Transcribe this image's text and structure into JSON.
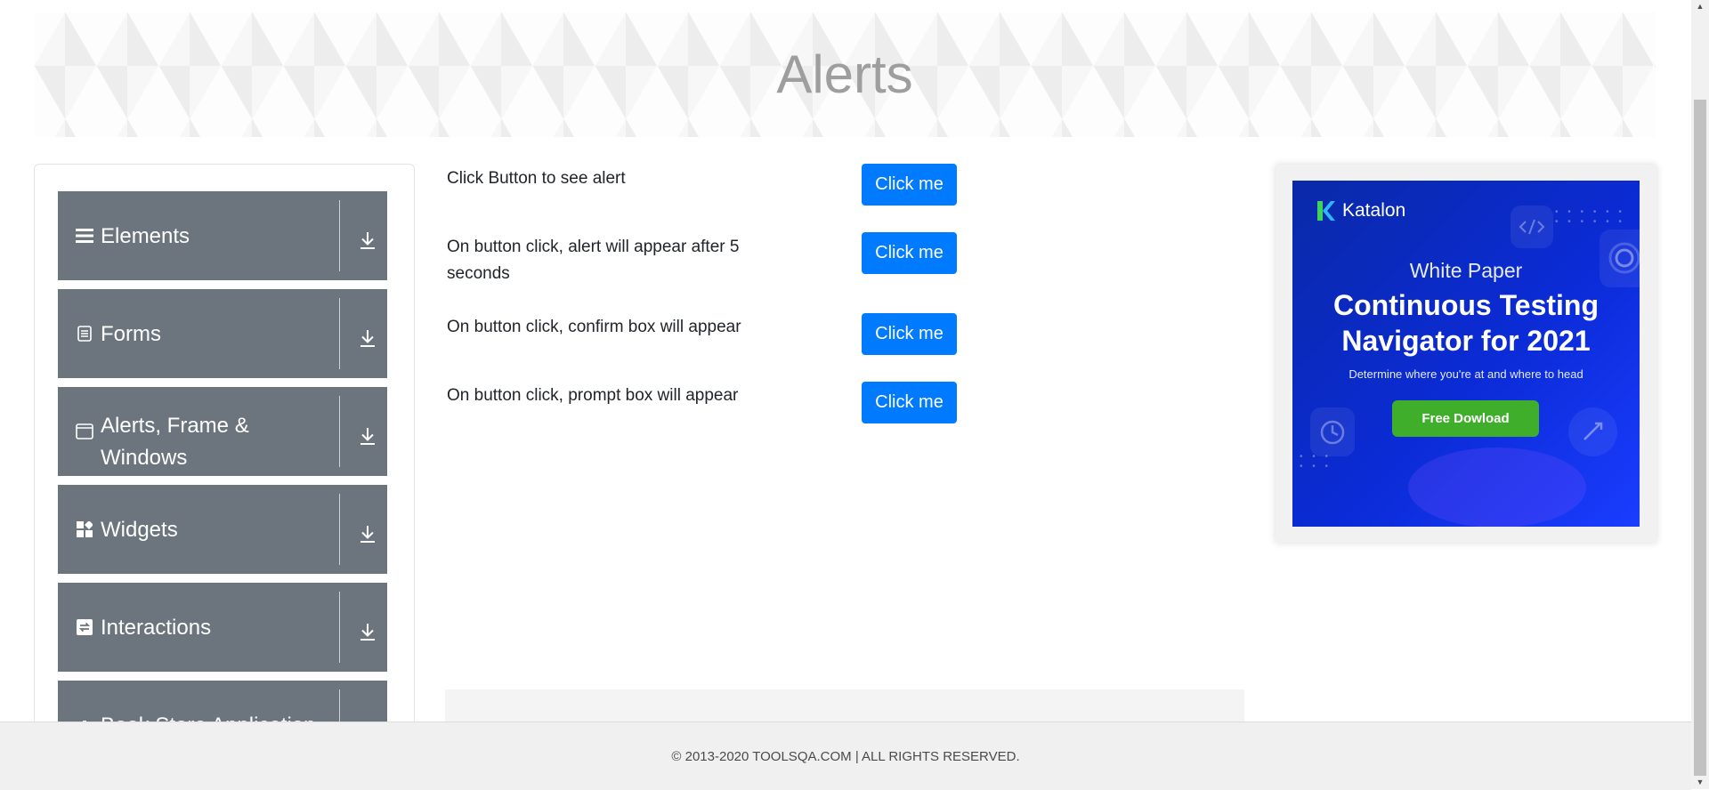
{
  "page": {
    "title": "Alerts"
  },
  "sidebar": {
    "groups": [
      {
        "label": "Elements",
        "icon": "menu-icon"
      },
      {
        "label": "Forms",
        "icon": "document-icon"
      },
      {
        "label": "Alerts, Frame & Windows",
        "icon": "window-icon"
      },
      {
        "label": "Widgets",
        "icon": "widgets-icon"
      },
      {
        "label": "Interactions",
        "icon": "interactions-icon"
      },
      {
        "label": "Book Store Application",
        "icon": "bookstore-icon"
      }
    ],
    "expand_icon": "download-arrow-icon"
  },
  "alerts": {
    "rows": [
      {
        "text": "Click Button to see alert",
        "button": "Click me"
      },
      {
        "text": "On button click, alert will appear after 5 seconds",
        "button": "Click me"
      },
      {
        "text": "On button click, confirm box will appear",
        "button": "Click me"
      },
      {
        "text": "On button click, prompt box will appear",
        "button": "Click me"
      }
    ]
  },
  "ad": {
    "brand": "Katalon",
    "kicker": "White Paper",
    "headline": "Continuous Testing Navigator for 2021",
    "subtext": "Determine where you're at and where to head",
    "cta": "Free Dowload",
    "colors": {
      "background": "#0b2bd6",
      "cta": "#3fae2a"
    }
  },
  "footer": {
    "text": "© 2013-2020 TOOLSQA.COM | ALL RIGHTS RESERVED."
  },
  "colors": {
    "button": "#007bff",
    "sidebar_group": "#6c757d"
  }
}
